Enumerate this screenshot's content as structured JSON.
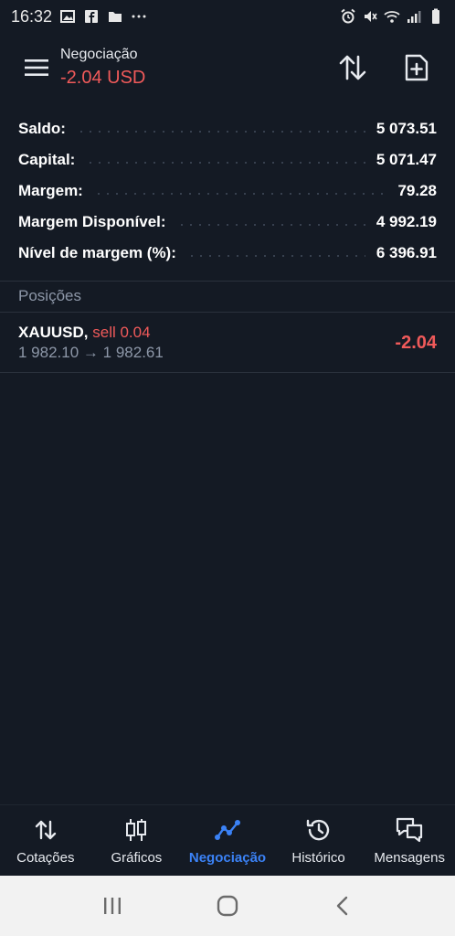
{
  "status_bar": {
    "time": "16:32",
    "icons_left": [
      "image-icon",
      "facebook-icon",
      "folder-icon",
      "more-icon"
    ],
    "icons_right": [
      "alarm-icon",
      "mute-icon",
      "wifi-icon",
      "signal-icon",
      "battery-icon"
    ]
  },
  "header": {
    "title": "Negociação",
    "subtitle": "-2.04 USD",
    "subtitle_color": "#f05a5a"
  },
  "summary": [
    {
      "label": "Saldo:",
      "value": "5 073.51"
    },
    {
      "label": "Capital:",
      "value": "5 071.47"
    },
    {
      "label": "Margem:",
      "value": "79.28"
    },
    {
      "label": "Margem Disponível:",
      "value": "4 992.19"
    },
    {
      "label": "Nível de margem (%):",
      "value": "6 396.91"
    }
  ],
  "positions": {
    "section_title": "Posições",
    "items": [
      {
        "symbol": "XAUUSD,",
        "type": "sell 0.04",
        "open_price": "1 982.10",
        "arrow": "→",
        "current_price": "1 982.61",
        "profit": "-2.04"
      }
    ]
  },
  "bottom_nav": [
    {
      "label": "Cotações",
      "icon": "sort-arrows-icon",
      "active": false
    },
    {
      "label": "Gráficos",
      "icon": "candlestick-icon",
      "active": false
    },
    {
      "label": "Negociação",
      "icon": "trend-line-icon",
      "active": true
    },
    {
      "label": "Histórico",
      "icon": "history-icon",
      "active": false
    },
    {
      "label": "Mensagens",
      "icon": "chat-icon",
      "active": false
    }
  ],
  "colors": {
    "background": "#141a24",
    "negative": "#f05a5a",
    "accent": "#3b82f6",
    "muted": "#8d97a8"
  }
}
